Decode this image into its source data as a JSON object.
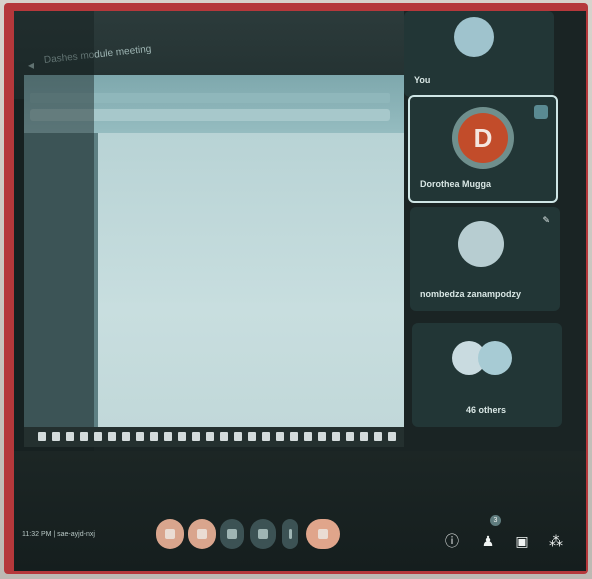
{
  "meeting": {
    "title": "Dashes module meeting",
    "back_icon": "arrow-left-icon"
  },
  "participants": [
    {
      "name": "You",
      "avatar_color": "#9fc3cd"
    },
    {
      "name": "Dorothea Mugga",
      "initial": "D",
      "avatar_color": "#c24c2a",
      "active": true
    },
    {
      "name": "nombedza zanampodzy",
      "avatar_color": "#b7cdd1",
      "muted_icon": "mic-off-icon"
    },
    {
      "name": "46 others",
      "avatar_color": "#a7cbd4"
    }
  ],
  "footer": {
    "clock_text": "11:32 PM  |  sae-ayjd-nxj"
  },
  "controls": {
    "left_icons": [
      "mic-icon",
      "camera-icon",
      "captions-icon",
      "present-icon",
      "more-icon",
      "end-call-icon"
    ],
    "right_icons": [
      "info-icon",
      "people-icon",
      "chat-icon",
      "activities-icon"
    ],
    "people_count": "3"
  },
  "colors": {
    "bezel": "#b5383b",
    "background": "#1a2424",
    "tile": "#223636",
    "accent": "#d9a58d"
  }
}
